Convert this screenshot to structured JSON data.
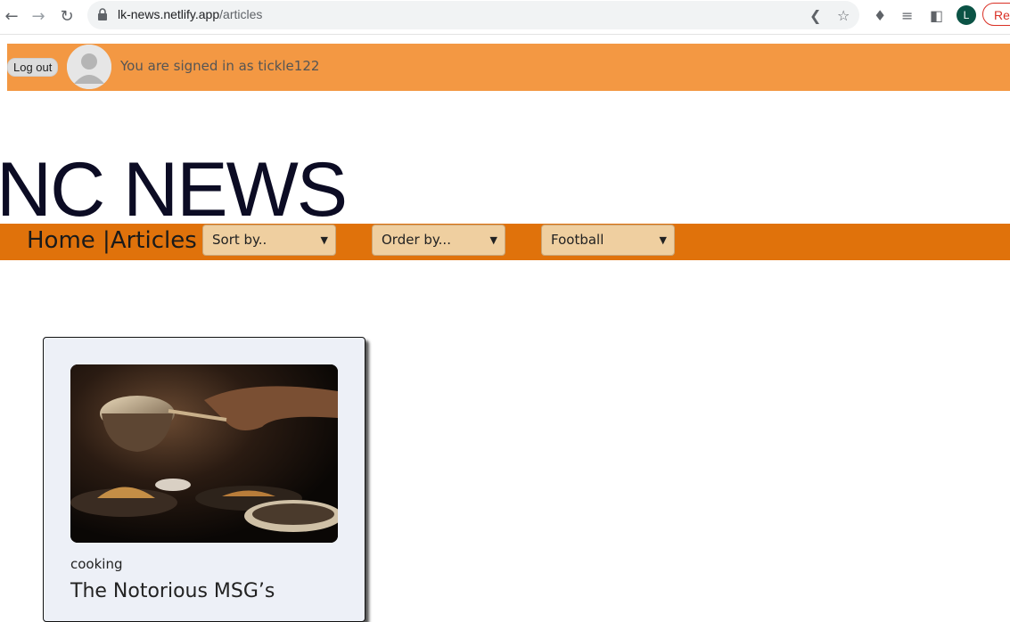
{
  "browser": {
    "url_host": "lk-news.netlify.app",
    "url_path": "/articles",
    "profile_initial": "L",
    "relaunch_label": "Re"
  },
  "userbar": {
    "logout_label": "Log out",
    "signed_in_text": "You are signed in as tickle122"
  },
  "site": {
    "title": "NC NEWS"
  },
  "nav": {
    "home_label": "Home |",
    "articles_label": "Articles",
    "sort_label": "Sort by..",
    "order_label": "Order by...",
    "topic_label": "Football"
  },
  "card": {
    "topic": "cooking",
    "title": "The Notorious MSG’s"
  },
  "colors": {
    "userbar": "#f39843",
    "navbar": "#e0720b",
    "select": "#efcfa0",
    "card": "#edf0f7"
  }
}
